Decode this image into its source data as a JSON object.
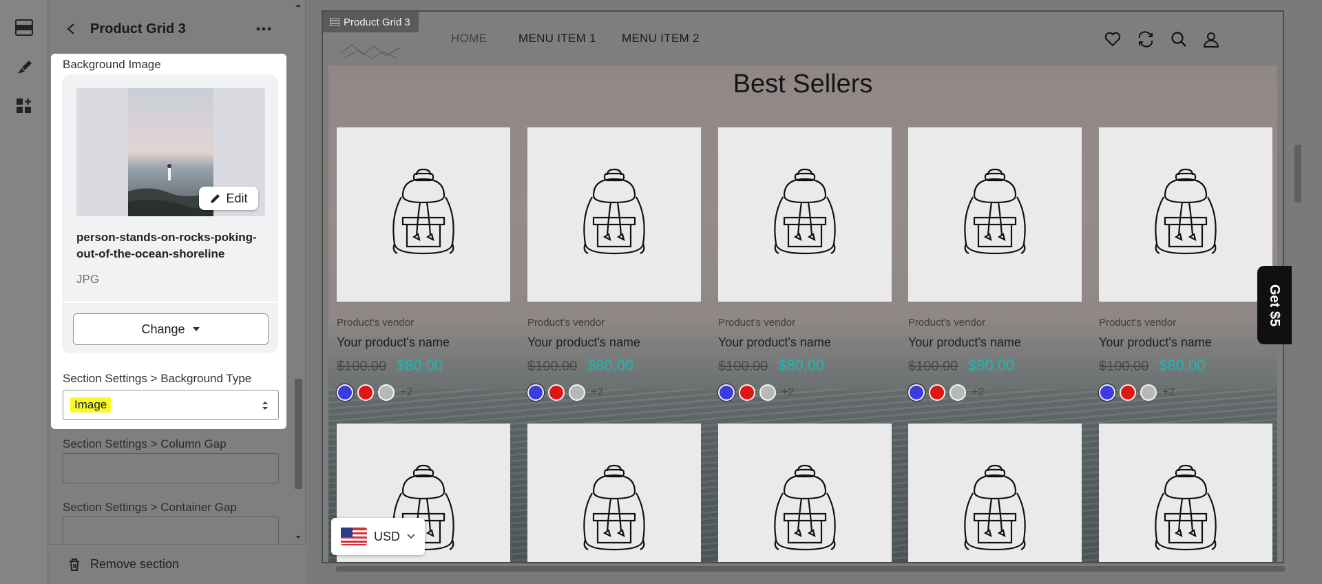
{
  "panel": {
    "title": "Product Grid 3",
    "background_image_label": "Background Image",
    "file_name": "person-stands-on-rocks-poking-out-of-the-ocean-shoreline",
    "file_type": "JPG",
    "edit_label": "Edit",
    "change_label": "Change",
    "background_type_label": "Section Settings > Background Type",
    "background_type_value": "Image",
    "column_gap_label": "Section Settings > Column Gap",
    "container_gap_label": "Section Settings > Container Gap",
    "remove_label": "Remove section"
  },
  "preview": {
    "section_tag": "Product Grid 3",
    "nav": [
      "HOME",
      "MENU ITEM 1",
      "MENU ITEM 2"
    ],
    "section_title": "Best Sellers",
    "get5_label": "Get $5",
    "currency": "USD",
    "products": [
      {
        "vendor": "Product's vendor",
        "name": "Your product's name",
        "old_price": "$100.00",
        "new_price": "$80.00",
        "more": "+2"
      },
      {
        "vendor": "Product's vendor",
        "name": "Your product's name",
        "old_price": "$100.00",
        "new_price": "$80.00",
        "more": "+2"
      },
      {
        "vendor": "Product's vendor",
        "name": "Your product's name",
        "old_price": "$100.00",
        "new_price": "$80.00",
        "more": "+2"
      },
      {
        "vendor": "Product's vendor",
        "name": "Your product's name",
        "old_price": "$100.00",
        "new_price": "$80.00",
        "more": "+2"
      },
      {
        "vendor": "Product's vendor",
        "name": "Your product's name",
        "old_price": "$100.00",
        "new_price": "$80.00",
        "more": "+2"
      }
    ],
    "swatch_colors": [
      "#3b3be0",
      "#e01616",
      "#b8b8b8"
    ]
  },
  "colors": {
    "price_accent": "#1cb8b0",
    "highlight": "#f8f82a"
  }
}
